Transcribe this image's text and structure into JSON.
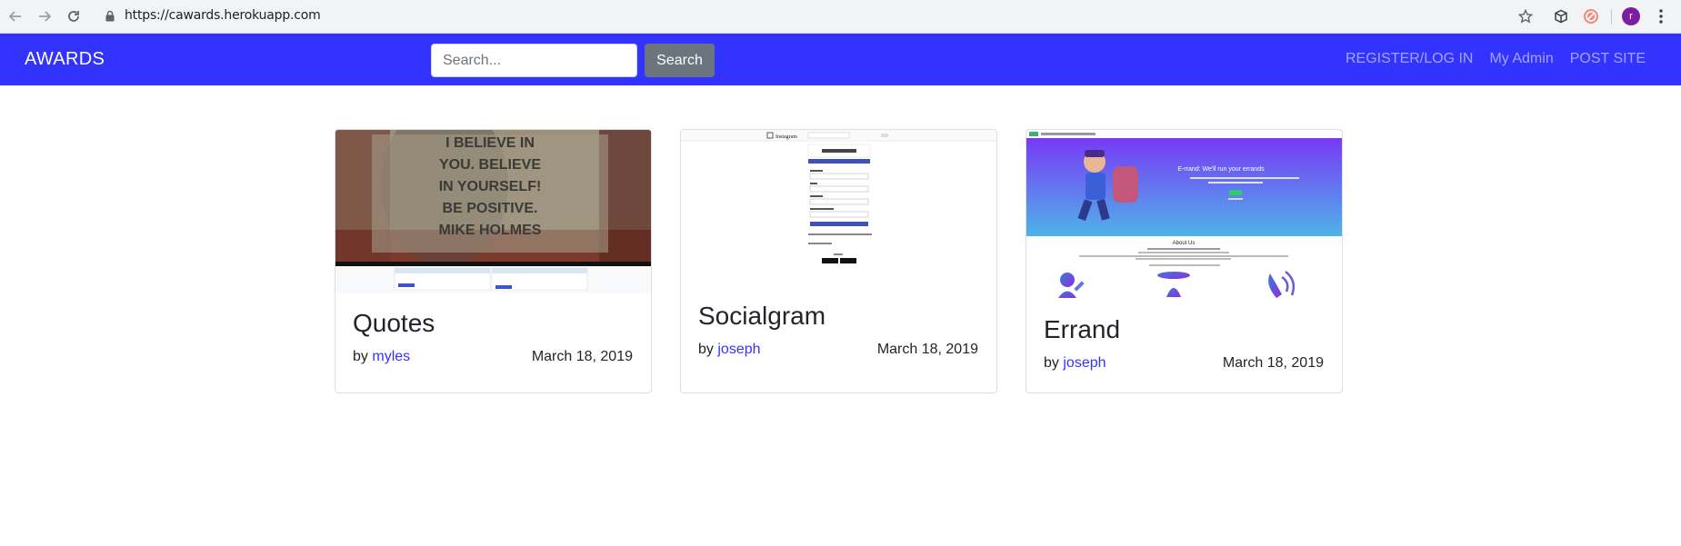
{
  "browser": {
    "url": "https://cawards.herokuapp.com",
    "profile_initial": "r"
  },
  "navbar": {
    "brand": "AWARDS",
    "search_placeholder": "Search...",
    "search_button": "Search",
    "links": [
      "REGISTER/LOG IN",
      "My Admin",
      "POST SITE"
    ]
  },
  "projects": [
    {
      "title": "Quotes",
      "by_label": "by",
      "author": "myles",
      "date": "March 18, 2019",
      "quote_lines": [
        "I BELIEVE IN",
        "YOU. BELIEVE",
        "IN YOURSELF!",
        "BE POSITIVE.",
        "MIKE HOLMES"
      ]
    },
    {
      "title": "Socialgram",
      "by_label": "by",
      "author": "joseph",
      "date": "March 18, 2019",
      "screenshot_brand": "Instagram"
    },
    {
      "title": "Errand",
      "by_label": "by",
      "author": "joseph",
      "date": "March 18, 2019",
      "hero_heading": "E-rrand: We'll run your errands",
      "section_heading": "About Us"
    }
  ],
  "colors": {
    "navbar": "#3333ff",
    "link": "#3333ff",
    "search_button": "#6c757d",
    "avatar": "#7b1fa2"
  }
}
